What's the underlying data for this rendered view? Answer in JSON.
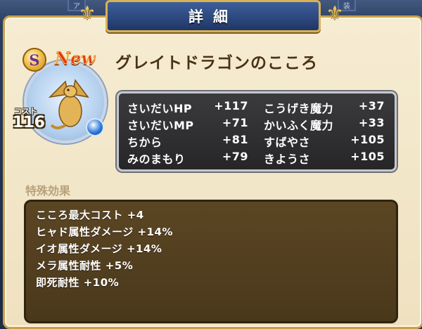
{
  "header": {
    "title": "詳細",
    "left_tab": "ア",
    "right_tab": "装"
  },
  "heart": {
    "rank": "S",
    "new_label": "New",
    "name": "グレイトドラゴンのこころ",
    "cost_label": "コスト",
    "cost_value": "116"
  },
  "stats": [
    {
      "label": "さいだいHP",
      "value": "+117"
    },
    {
      "label": "こうげき魔力",
      "value": "+37"
    },
    {
      "label": "さいだいMP",
      "value": "+71"
    },
    {
      "label": "かいふく魔力",
      "value": "+33"
    },
    {
      "label": "ちから",
      "value": "+81"
    },
    {
      "label": "すばやさ",
      "value": "+105"
    },
    {
      "label": "みのまもり",
      "value": "+79"
    },
    {
      "label": "きようさ",
      "value": "+105"
    }
  ],
  "special": {
    "label": "特殊効果",
    "effects": [
      "こころ最大コスト +4",
      "ヒャド属性ダメージ +14%",
      "イオ属性ダメージ +14%",
      "メラ属性耐性 +5%",
      "即死耐性 +10%"
    ]
  },
  "colors": {
    "panel": "#f3e7c9",
    "title_plate": "#2c4a80",
    "gold_border": "#caa04b",
    "stats_bg": "#303032",
    "effects_bg": "#52401f",
    "name_text": "#4a3215"
  },
  "icons": {
    "rank": "rank-s-badge",
    "orb": "blue-orb-icon",
    "portrait": "great-dragon-portrait",
    "ornament": "fleur-de-lis-ornament"
  }
}
